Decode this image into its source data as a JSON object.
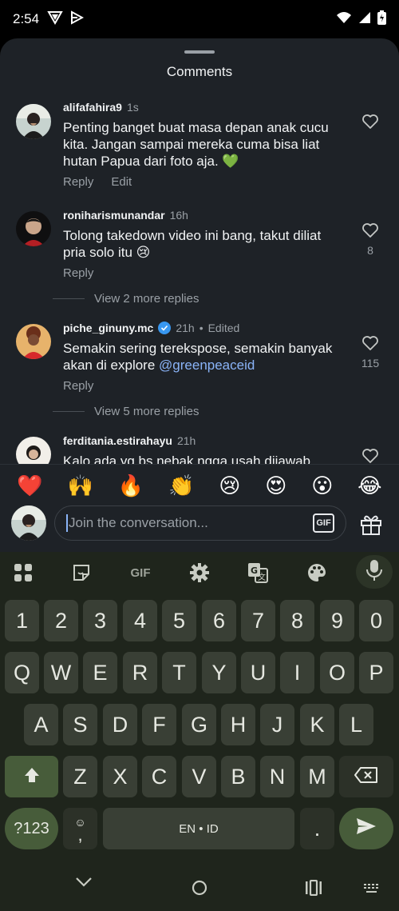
{
  "status_bar": {
    "time": "2:54",
    "left_icons": [
      "vpn-shield-icon",
      "play-triangle-icon"
    ],
    "right_icons": [
      "wifi-icon",
      "signal-icon",
      "battery-icon"
    ]
  },
  "sheet": {
    "title": "Comments"
  },
  "comments": [
    {
      "username": "alifafahira9",
      "time": "1s",
      "edited": "",
      "verified": false,
      "text": "Penting banget buat masa depan anak cucu kita. Jangan sampai mereka cuma bisa liat hutan Papua dari foto aja. 💚",
      "mention": "",
      "reply_label": "Reply",
      "edit_label": "Edit",
      "likes": ""
    },
    {
      "username": "roniharismunandar",
      "time": "16h",
      "edited": "",
      "verified": false,
      "text": "Tolong takedown video ini bang, takut diliat pria solo itu 😢",
      "mention": "",
      "reply_label": "Reply",
      "edit_label": "",
      "likes": "8",
      "view_replies": "View 2 more replies"
    },
    {
      "username": "piche_ginuny.mc",
      "time": "21h",
      "edited": "Edited",
      "verified": true,
      "text": "Semakin sering terekspose, semakin banyak akan di explore ",
      "mention": "@greenpeaceid",
      "reply_label": "Reply",
      "edit_label": "",
      "likes": "115",
      "view_replies": "View 5 more replies"
    },
    {
      "username": "ferditania.estirahayu",
      "time": "21h",
      "edited": "",
      "verified": false,
      "text": "Kalo ada yg bs nebak ngga usah dijawab",
      "mention": "",
      "reply_label": "",
      "edit_label": "",
      "likes": ""
    }
  ],
  "emoji_bar": [
    "❤️",
    "🙌",
    "🔥",
    "👏",
    "😢",
    "😍",
    "😮",
    "😂"
  ],
  "input": {
    "placeholder": "Join the conversation...",
    "gif_label": "GIF"
  },
  "keyboard": {
    "tools": [
      "apps-grid-icon",
      "sticker-icon",
      "gif-icon",
      "settings-gear-icon",
      "translate-icon",
      "palette-icon",
      "mic-icon"
    ],
    "tool_gif_label": "GIF",
    "row_numbers": [
      "1",
      "2",
      "3",
      "4",
      "5",
      "6",
      "7",
      "8",
      "9",
      "0"
    ],
    "row_1": [
      "Q",
      "W",
      "E",
      "R",
      "T",
      "Y",
      "U",
      "I",
      "O",
      "P"
    ],
    "row_2": [
      "A",
      "S",
      "D",
      "F",
      "G",
      "H",
      "J",
      "K",
      "L"
    ],
    "row_3": [
      "Z",
      "X",
      "C",
      "V",
      "B",
      "N",
      "M"
    ],
    "symbols_label": "?123",
    "emoji_comma_top": "☺",
    "emoji_comma_bottom": ",",
    "space_label": "EN • ID",
    "period_label": "."
  },
  "navbar": [
    "back-chevron-icon",
    "home-circle-icon",
    "recents-icon",
    "keyboard-switch-icon"
  ]
}
